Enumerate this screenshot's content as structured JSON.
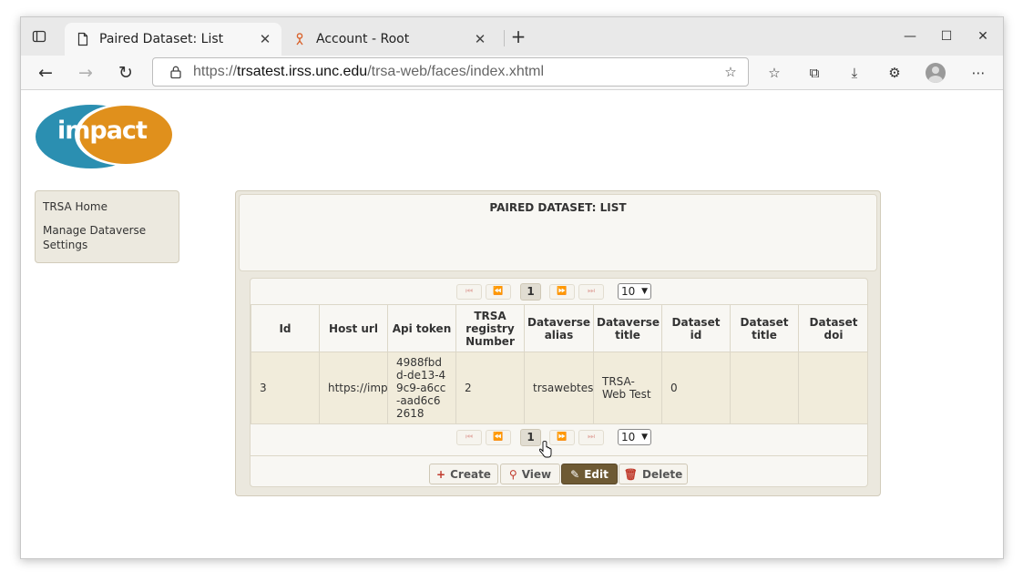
{
  "browser": {
    "tabs": [
      {
        "title": "Paired Dataset: List",
        "close": "✕"
      },
      {
        "title": "Account - Root",
        "close": "✕"
      }
    ],
    "url_prefix": "https://",
    "url_host": "trsatest.irss.unc.edu",
    "url_path": "/trsa-web/faces/index.xhtml"
  },
  "logo": {
    "text": "impact",
    "colors": {
      "blue": "#2b8fb1",
      "orange": "#e0901c"
    }
  },
  "menu": {
    "items": [
      "TRSA Home",
      "Manage Dataverse Settings"
    ]
  },
  "panel": {
    "title": "PAIRED DATASET: LIST"
  },
  "paginator": {
    "first": "⏮",
    "prev": "⏪",
    "next": "⏩",
    "last": "⏭",
    "page": "1",
    "rows": "10"
  },
  "table": {
    "columns": [
      "Id",
      "Host url",
      "Api token",
      "TRSA registry Number",
      "Dataverse alias",
      "Dataverse title",
      "Dataset id",
      "Dataset title",
      "Dataset doi"
    ],
    "rows": [
      [
        "3",
        "https://imp",
        "4988fbdd-de13-49c9-a6cc-aad6c62618",
        "2",
        "trsawebtest",
        "TRSA-Web Test",
        "0",
        "",
        ""
      ]
    ]
  },
  "actions": {
    "create": "Create",
    "view": "View",
    "edit": "Edit",
    "delete": "Delete"
  }
}
